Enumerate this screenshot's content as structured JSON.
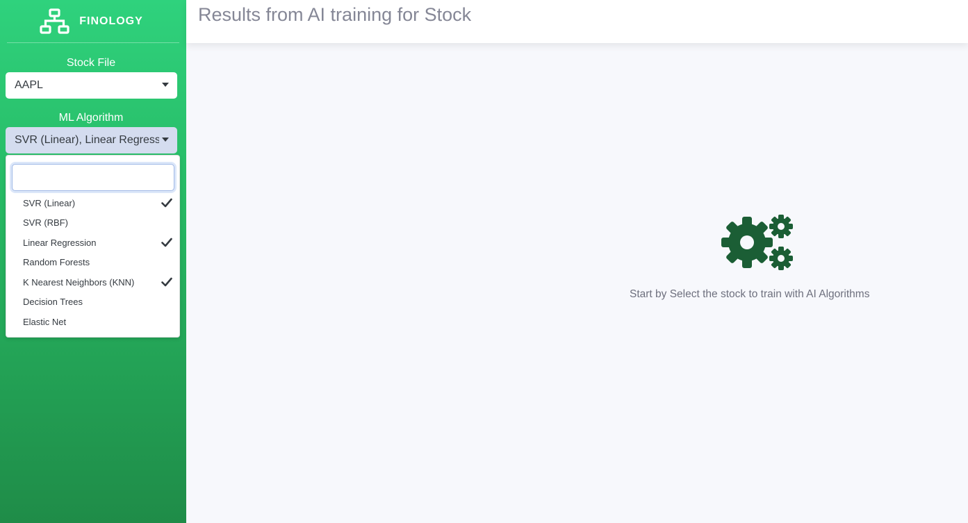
{
  "brand": {
    "name": "FINOLOGY",
    "icon": "sitemap-icon"
  },
  "colors": {
    "sidebar_top": "#2fd27d",
    "sidebar_bottom": "#1f8c48",
    "gear": "#1b5e35",
    "title": "#858796"
  },
  "sidebar": {
    "stock_label": "Stock File",
    "stock_value": "AAPL",
    "algo_label": "ML Algorithm",
    "algo_value": "SVR (Linear), Linear Regressi"
  },
  "dropdown": {
    "search_value": "",
    "search_placeholder": "",
    "items": [
      {
        "label": "SVR (Linear)",
        "checked": true
      },
      {
        "label": "SVR (RBF)",
        "checked": false
      },
      {
        "label": "Linear Regression",
        "checked": true
      },
      {
        "label": "Random Forests",
        "checked": false
      },
      {
        "label": "K Nearest Neighbors (KNN)",
        "checked": true
      },
      {
        "label": "Decision Trees",
        "checked": false
      },
      {
        "label": "Elastic Net",
        "checked": false
      }
    ]
  },
  "header": {
    "title": "Results from AI training for Stock"
  },
  "main": {
    "empty_icon": "gears-icon",
    "empty_message": "Start by Select the stock to train with AI Algorithms"
  }
}
